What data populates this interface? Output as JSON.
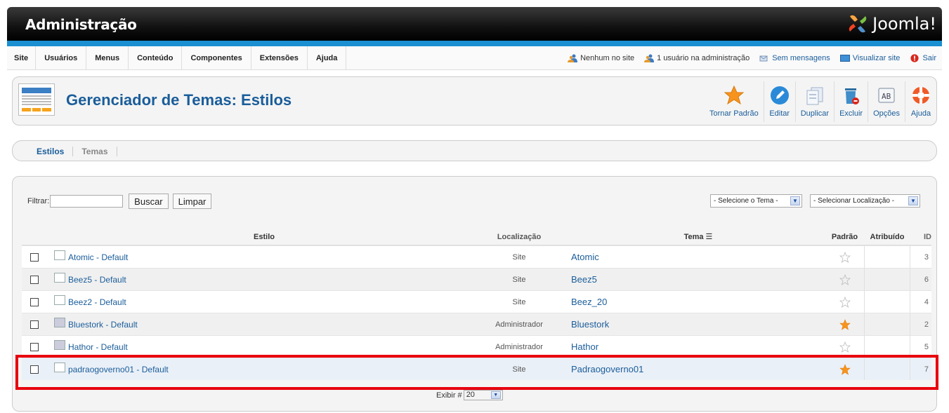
{
  "header": {
    "title": "Administração",
    "logo_text": "Joomla!"
  },
  "menu": [
    "Site",
    "Usuários",
    "Menus",
    "Conteúdo",
    "Componentes",
    "Extensões",
    "Ajuda"
  ],
  "status": {
    "users_site": "Nenhum no site",
    "users_admin": "1 usuário na administração",
    "messages": "Sem mensagens",
    "view_site": "Visualizar site",
    "logout": "Sair"
  },
  "page": {
    "title": "Gerenciador de Temas: Estilos"
  },
  "toolbar": [
    "Tornar Padrão",
    "Editar",
    "Duplicar",
    "Excluir",
    "Opções",
    "Ajuda"
  ],
  "tabs": [
    "Estilos",
    "Temas"
  ],
  "filter": {
    "label": "Filtrar:",
    "value": "",
    "search_button": "Buscar",
    "clear_button": "Limpar",
    "template_select": "- Selecione o Tema -",
    "location_select": "- Selecionar Localização -"
  },
  "table": {
    "columns": [
      "Estilo",
      "Localização",
      "Tema",
      "Padrão",
      "Atribuído",
      "ID"
    ],
    "rows": [
      {
        "name": "Atomic - Default",
        "location": "Site",
        "template": "Atomic",
        "default": false,
        "id": "3"
      },
      {
        "name": "Beez5 - Default",
        "location": "Site",
        "template": "Beez5",
        "default": false,
        "id": "6"
      },
      {
        "name": "Beez2 - Default",
        "location": "Site",
        "template": "Beez_20",
        "default": false,
        "id": "4"
      },
      {
        "name": "Bluestork - Default",
        "location": "Administrador",
        "template": "Bluestork",
        "default": true,
        "id": "2"
      },
      {
        "name": "Hathor - Default",
        "location": "Administrador",
        "template": "Hathor",
        "default": false,
        "id": "5"
      },
      {
        "name": "padraogoverno01 - Default",
        "location": "Site",
        "template": "Padraogoverno01",
        "default": true,
        "id": "7"
      }
    ]
  },
  "pager": {
    "label": "Exibir #",
    "value": "20"
  },
  "colors": {
    "accent": "#1a5d9a",
    "highlight": "#e8000e",
    "star_on": "#f7941d"
  }
}
